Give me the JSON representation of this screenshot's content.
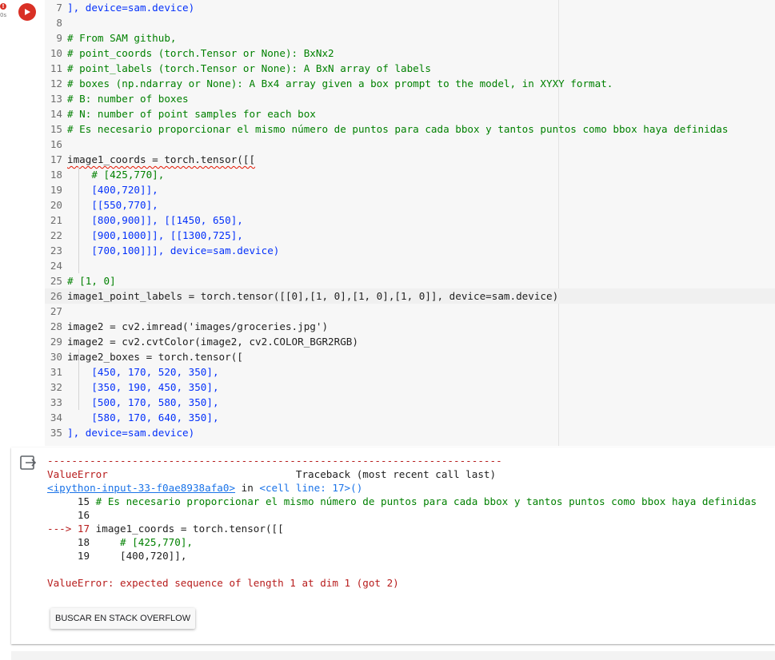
{
  "cell": {
    "run_time": "0s",
    "error_badge": "!",
    "lines": [
      {
        "n": "7",
        "text": "], device=sam.device)"
      },
      {
        "n": "8",
        "text": ""
      },
      {
        "n": "9",
        "text": "# From SAM github,"
      },
      {
        "n": "10",
        "text": "# point_coords (torch.Tensor or None): BxNx2"
      },
      {
        "n": "11",
        "text": "# point_labels (torch.Tensor or None): A BxN array of labels"
      },
      {
        "n": "12",
        "text": "# boxes (np.ndarray or None): A Bx4 array given a box prompt to the model, in XYXY format."
      },
      {
        "n": "13",
        "text": "# B: number of boxes"
      },
      {
        "n": "14",
        "text": "# N: number of point samples for each box"
      },
      {
        "n": "15",
        "text": "# Es necesario proporcionar el mismo número de puntos para cada bbox y tantos puntos como bbox haya definidas"
      },
      {
        "n": "16",
        "text": ""
      },
      {
        "n": "17",
        "text": "image1_coords = torch.tensor([["
      },
      {
        "n": "18",
        "text": "    # [425,770],"
      },
      {
        "n": "19",
        "text": "    [400,720]],"
      },
      {
        "n": "20",
        "text": "    [[550,770],"
      },
      {
        "n": "21",
        "text": "    [800,900]], [[1450, 650],"
      },
      {
        "n": "22",
        "text": "    [900,1000]], [[1300,725],"
      },
      {
        "n": "23",
        "text": "    [700,100]]], device=sam.device)"
      },
      {
        "n": "24",
        "text": ""
      },
      {
        "n": "25",
        "text": "# [1, 0]"
      },
      {
        "n": "26",
        "text": "image1_point_labels = torch.tensor([[0],[1, 0],[1, 0],[1, 0]], device=sam.device)"
      },
      {
        "n": "27",
        "text": ""
      },
      {
        "n": "28",
        "text": "image2 = cv2.imread('images/groceries.jpg')"
      },
      {
        "n": "29",
        "text": "image2 = cv2.cvtColor(image2, cv2.COLOR_BGR2RGB)"
      },
      {
        "n": "30",
        "text": "image2_boxes = torch.tensor(["
      },
      {
        "n": "31",
        "text": "    [450, 170, 520, 350],"
      },
      {
        "n": "32",
        "text": "    [350, 190, 450, 350],"
      },
      {
        "n": "33",
        "text": "    [500, 170, 580, 350],"
      },
      {
        "n": "34",
        "text": "    [580, 170, 640, 350],"
      },
      {
        "n": "35",
        "text": "], device=sam.device)"
      }
    ]
  },
  "output": {
    "dashes": "---------------------------------------------------------------------------",
    "error_name": "ValueError",
    "traceback_header": "Traceback (most recent call last)",
    "input_link": "<ipython-input-33-f0ae8938afa0>",
    "in_word": " in ",
    "cell_ref": "<cell line: 17>()",
    "context": [
      {
        "prefix": "     15 ",
        "text": "# Es necesario proporcionar el mismo número de puntos para cada bbox y tantos puntos como bbox haya definidas"
      },
      {
        "prefix": "     16 ",
        "text": ""
      },
      {
        "prefix": "---> 17 ",
        "text": "image1_coords = torch.tensor([["
      },
      {
        "prefix": "     18 ",
        "text": "    # [425,770],"
      },
      {
        "prefix": "     19 ",
        "text": "    [400,720]],"
      }
    ],
    "error_message": "ValueError: expected sequence of length 1 at dim 1 (got 2)",
    "stack_button": "BUSCAR EN STACK OVERFLOW"
  }
}
